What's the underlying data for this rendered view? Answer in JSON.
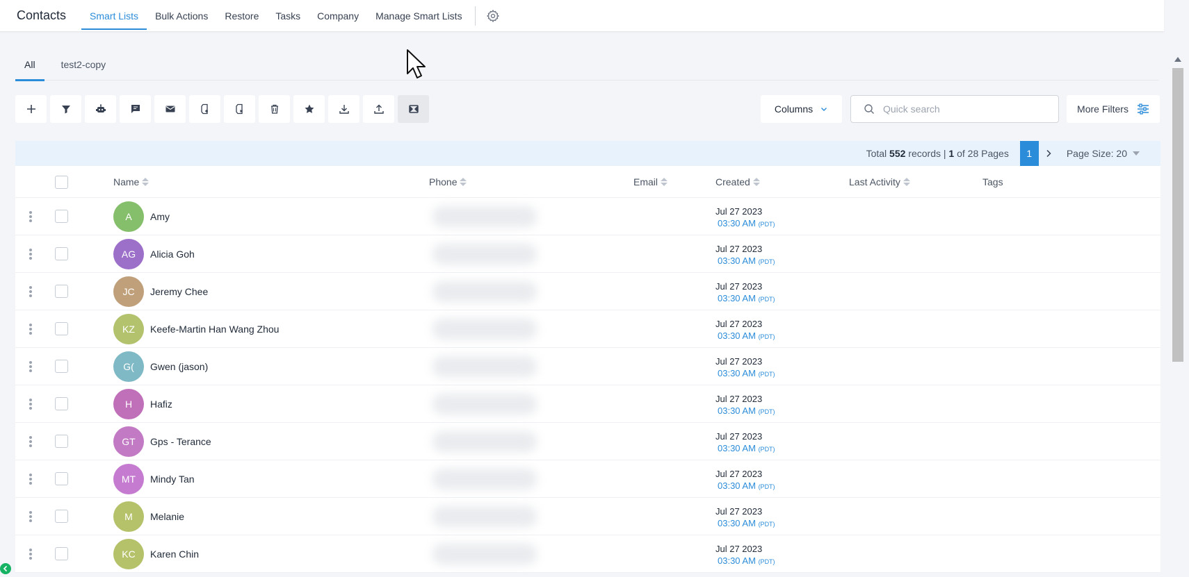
{
  "app": {
    "title": "Contacts"
  },
  "nav": {
    "items": [
      {
        "label": "Smart Lists",
        "active": true
      },
      {
        "label": "Bulk Actions",
        "active": false
      },
      {
        "label": "Restore",
        "active": false
      },
      {
        "label": "Tasks",
        "active": false
      },
      {
        "label": "Company",
        "active": false
      },
      {
        "label": "Manage Smart Lists",
        "active": false
      }
    ],
    "settings_icon": "gear-icon"
  },
  "subtabs": [
    {
      "label": "All",
      "active": true
    },
    {
      "label": "test2-copy",
      "active": false
    }
  ],
  "toolbar": {
    "buttons": [
      "plus-icon",
      "filter-icon",
      "robot-icon",
      "message-icon",
      "mail-icon",
      "tag-add-icon",
      "tag-remove-icon",
      "trash-icon",
      "star-icon",
      "download-icon",
      "upload-icon",
      "merge-icon"
    ],
    "columns_label": "Columns",
    "search_placeholder": "Quick search",
    "more_filters_label": "More Filters"
  },
  "pagination": {
    "total_prefix": "Total",
    "total": "552",
    "records_label": "records |",
    "current": "1",
    "of_pages": "of 28 Pages",
    "page_button": "1",
    "page_size_label": "Page Size: 20"
  },
  "table": {
    "headers": {
      "name": "Name",
      "phone": "Phone",
      "email": "Email",
      "created": "Created",
      "last_activity": "Last Activity",
      "tags": "Tags"
    },
    "rows": [
      {
        "initials": "A",
        "name": "Amy",
        "color": "#86bf6b",
        "date": "Jul 27 2023",
        "time": "03:30 AM",
        "tz": "(PDT)"
      },
      {
        "initials": "AG",
        "name": "Alicia Goh",
        "color": "#9c6fc9",
        "date": "Jul 27 2023",
        "time": "03:30 AM",
        "tz": "(PDT)"
      },
      {
        "initials": "JC",
        "name": "Jeremy Chee",
        "color": "#c0a07a",
        "date": "Jul 27 2023",
        "time": "03:30 AM",
        "tz": "(PDT)"
      },
      {
        "initials": "KZ",
        "name": "Keefe-Martin Han Wang Zhou",
        "color": "#b2c26d",
        "date": "Jul 27 2023",
        "time": "03:30 AM",
        "tz": "(PDT)"
      },
      {
        "initials": "G(",
        "name": "Gwen (jason)",
        "color": "#7fb9c6",
        "date": "Jul 27 2023",
        "time": "03:30 AM",
        "tz": "(PDT)"
      },
      {
        "initials": "H",
        "name": "Hafiz",
        "color": "#c06fb9",
        "date": "Jul 27 2023",
        "time": "03:30 AM",
        "tz": "(PDT)"
      },
      {
        "initials": "GT",
        "name": "Gps - Terance",
        "color": "#c17ac3",
        "date": "Jul 27 2023",
        "time": "03:30 AM",
        "tz": "(PDT)"
      },
      {
        "initials": "MT",
        "name": "Mindy Tan",
        "color": "#c47bd0",
        "date": "Jul 27 2023",
        "time": "03:30 AM",
        "tz": "(PDT)"
      },
      {
        "initials": "M",
        "name": "Melanie",
        "color": "#b5c26a",
        "date": "Jul 27 2023",
        "time": "03:30 AM",
        "tz": "(PDT)"
      },
      {
        "initials": "KC",
        "name": "Karen Chin",
        "color": "#b5c26a",
        "date": "Jul 27 2023",
        "time": "03:30 AM",
        "tz": "(PDT)"
      }
    ]
  },
  "colors": {
    "accent": "#2b8cd9",
    "page_bg": "#f3f5f9",
    "pager_bg": "#e8f2fd"
  }
}
